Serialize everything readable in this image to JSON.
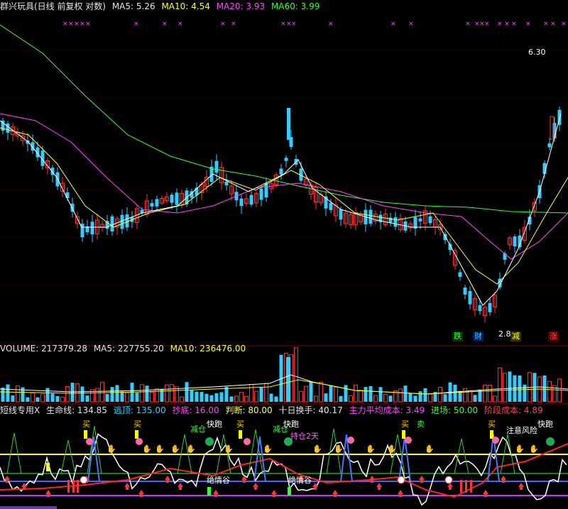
{
  "price_header": {
    "title": "群兴玩具(日线 前复权 对数)",
    "ma5": "MA5: 5.26",
    "ma10": "MA10: 4.54",
    "ma20": "MA20: 3.93",
    "ma60": "MA60: 3.99"
  },
  "volume_header": {
    "volume": "VOLUME: 217379.28",
    "ma5": "MA5: 227755.20",
    "ma10": "MA10: 236476.00"
  },
  "indicator_header": {
    "name": "短线专用X",
    "life_line": "生命线: 134.85",
    "escape_top": "逃顶: 135.00",
    "buy_bottom": "抄底: 16.00",
    "judge": "判断: 80.00",
    "ten_day_turnover": "十日换手: 40.17",
    "main_cost": "主力平均成本: 3.49",
    "entry": "进场: 50.00",
    "stage_cost": "阶段成本: 4.89"
  },
  "annotations": {
    "high_price": "6.30",
    "low_price": "2.8",
    "tag_fall": "跌",
    "tag_money": "财",
    "tag_reduce": "减",
    "tag_rise": "涨",
    "buy_mark": "买",
    "sell_mark": "卖",
    "reduce_mark": "减仓",
    "run_mark": "快跑",
    "hold_mark": "持仓2天",
    "jueqing_1": "绝情谷",
    "jueqing_2": "绝情谷",
    "risk_mark": "注意风险"
  },
  "colors": {
    "up": "#ff3333",
    "down": "#33ccff",
    "ma5": "#ffffff",
    "ma10": "#ffff33",
    "ma20": "#ff44ff",
    "ma60": "#33ff33"
  },
  "chart_data": [
    {
      "type": "candlestick",
      "scale": "log",
      "series_names": [
        "MA5",
        "MA10",
        "MA20",
        "MA60"
      ],
      "last": {
        "MA5": 5.26,
        "MA10": 4.54,
        "MA20": 3.93,
        "MA60": 3.99
      },
      "annotated_high": 6.3,
      "annotated_low": 2.8,
      "ylim": [
        2.7,
        6.6
      ]
    },
    {
      "type": "bar",
      "series_names": [
        "VOLUME",
        "MA5",
        "MA10"
      ],
      "last": {
        "VOLUME": 217379.28,
        "MA5": 227755.2,
        "MA10": 236476.0
      }
    },
    {
      "type": "line",
      "series_names": [
        "生命线",
        "逃顶",
        "抄底",
        "判断",
        "十日换手",
        "主力平均成本",
        "进场",
        "阶段成本"
      ],
      "last": {
        "生命线": 134.85,
        "逃顶": 135.0,
        "抄底": 16.0,
        "判断": 80.0,
        "十日换手": 40.17,
        "主力平均成本": 3.49,
        "进场": 50.0,
        "阶段成本": 4.89
      }
    }
  ]
}
